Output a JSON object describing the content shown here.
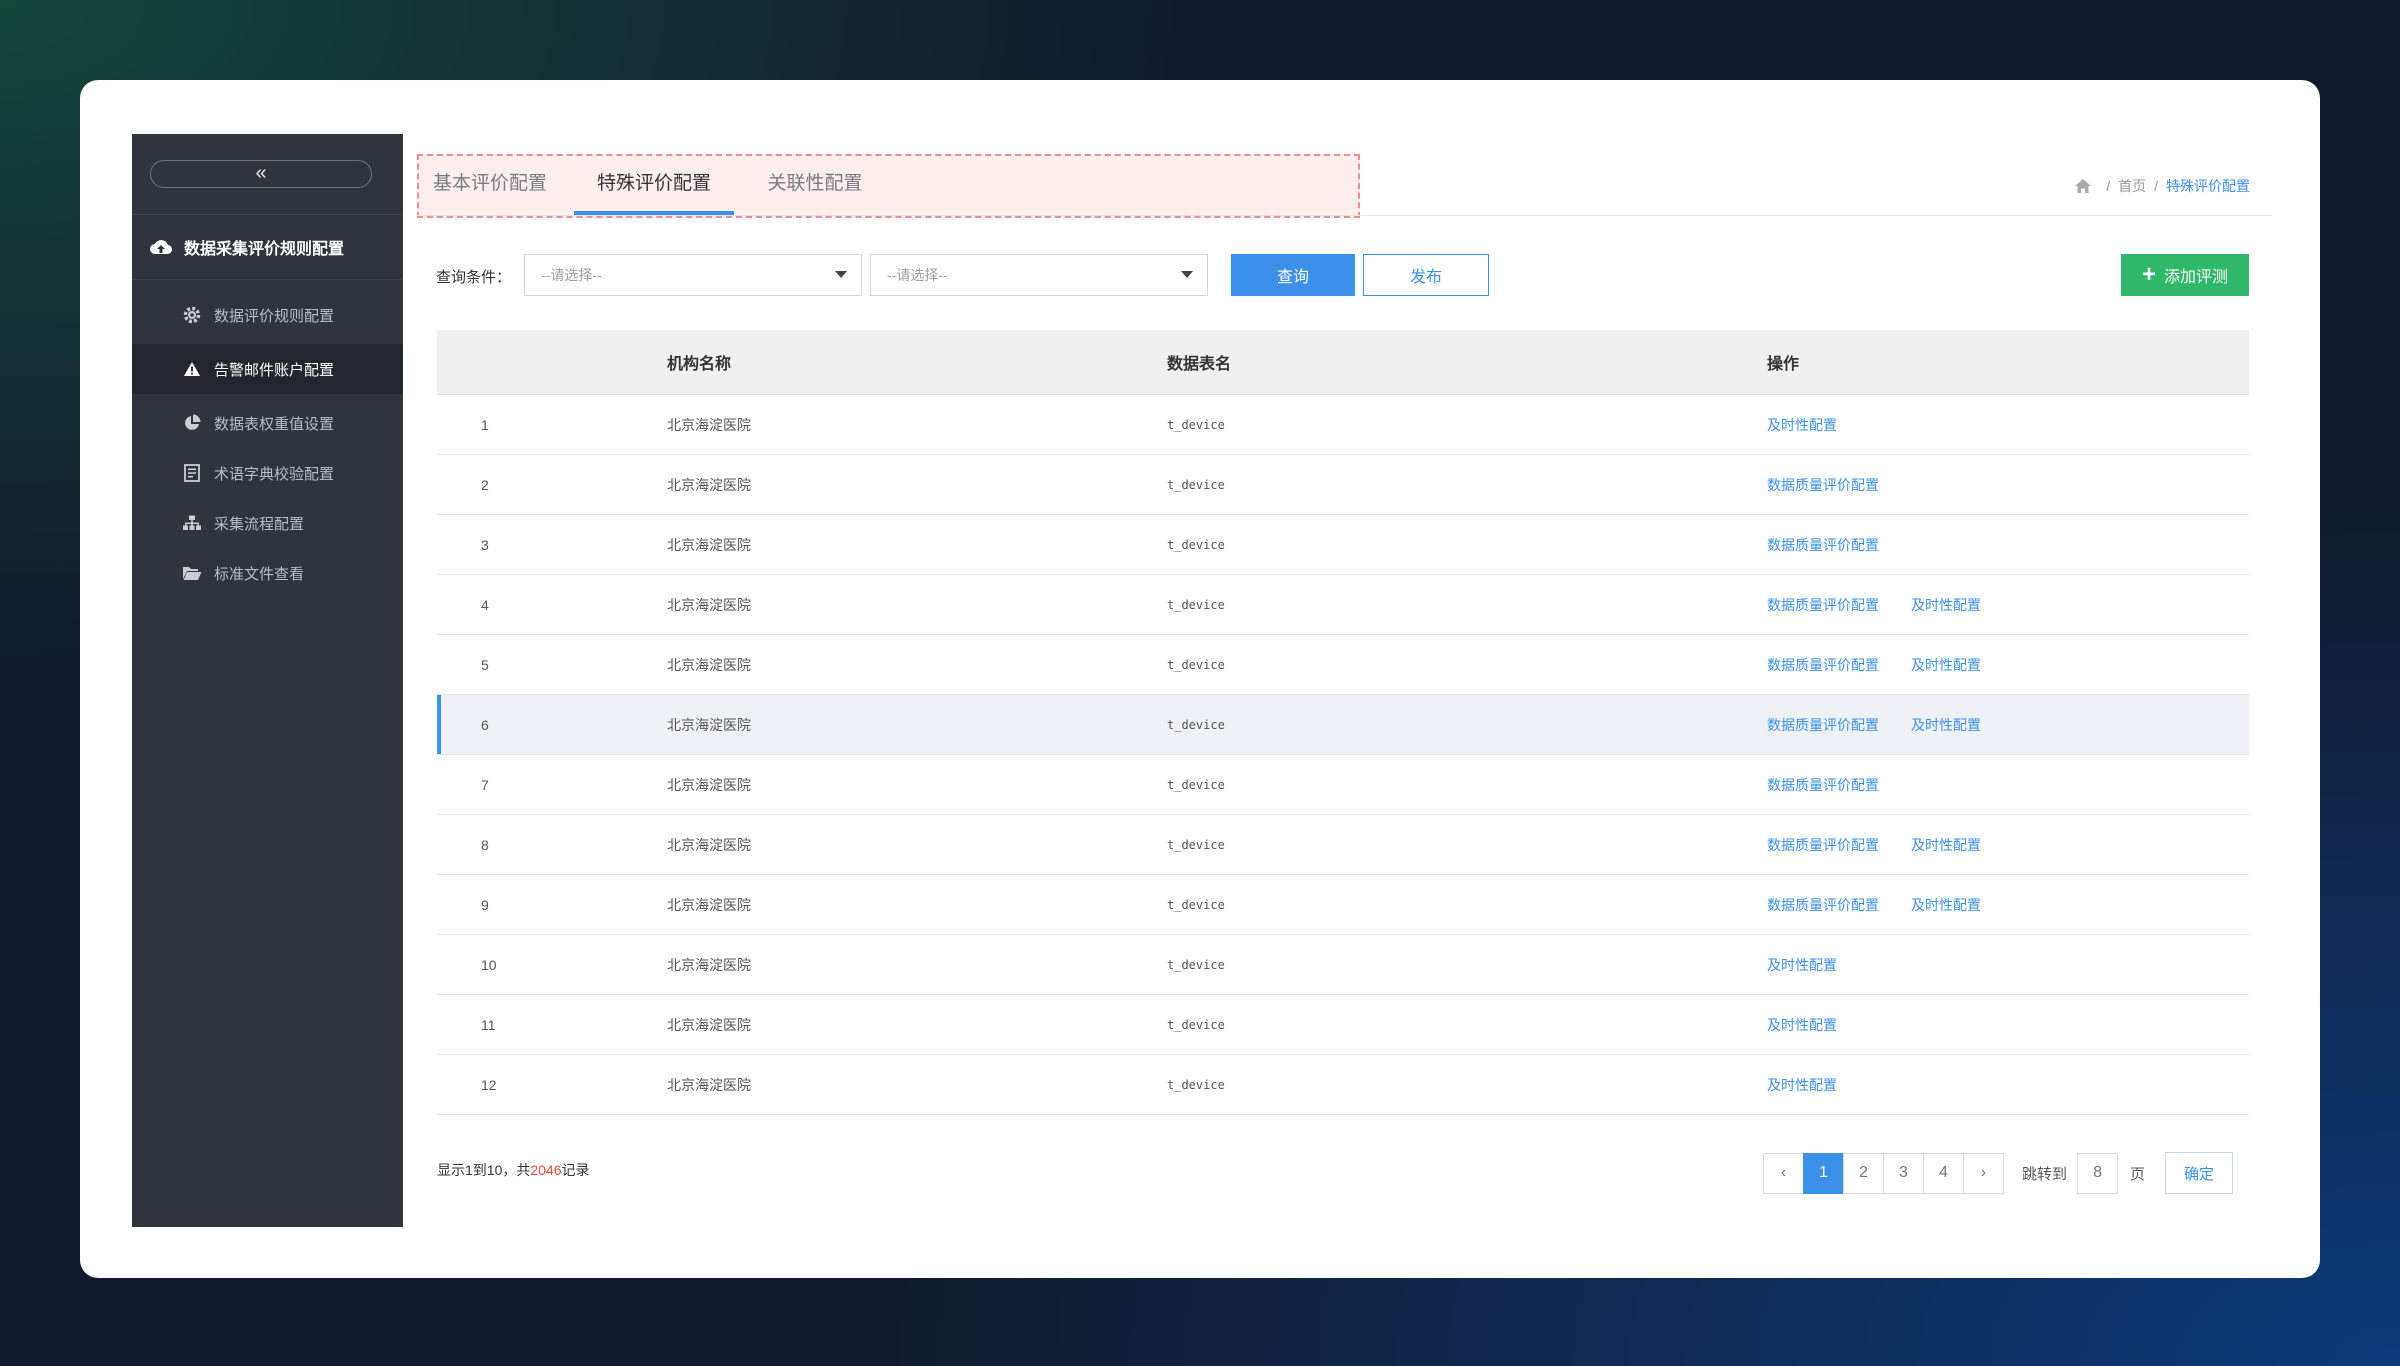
{
  "sidebar": {
    "collapse_glyph": "«",
    "group_label": "数据采集评价规则配置",
    "items": [
      {
        "label": "数据评价规则配置",
        "icon": "gear-icon"
      },
      {
        "label": "告警邮件账户配置",
        "icon": "warning-icon"
      },
      {
        "label": "数据表权重值设置",
        "icon": "pie-chart-icon"
      },
      {
        "label": "术语字典校验配置",
        "icon": "dictionary-icon"
      },
      {
        "label": "采集流程配置",
        "icon": "flow-icon"
      },
      {
        "label": "标准文件查看",
        "icon": "folder-open-icon"
      }
    ]
  },
  "tabs": [
    {
      "label": "基本评价配置"
    },
    {
      "label": "特殊评价配置"
    },
    {
      "label": "关联性配置"
    }
  ],
  "breadcrumb": {
    "home": "首页",
    "separator": "/",
    "current": "特殊评价配置"
  },
  "filter": {
    "label": "查询条件：",
    "select1_placeholder": "--请选择--",
    "select2_placeholder": "--请选择--",
    "query_button": "查询",
    "publish_button": "发布",
    "add_button": "添加评测",
    "add_plus": "+"
  },
  "table": {
    "headers": [
      "",
      "机构名称",
      "数据表名",
      "操作"
    ],
    "rows": [
      {
        "no": "1",
        "org": "北京海淀医院",
        "table": "t_device",
        "ops": [
          "及时性配置"
        ]
      },
      {
        "no": "2",
        "org": "北京海淀医院",
        "table": "t_device",
        "ops": [
          "数据质量评价配置"
        ]
      },
      {
        "no": "3",
        "org": "北京海淀医院",
        "table": "t_device",
        "ops": [
          "数据质量评价配置"
        ]
      },
      {
        "no": "4",
        "org": "北京海淀医院",
        "table": "t_device",
        "ops": [
          "数据质量评价配置",
          "及时性配置"
        ]
      },
      {
        "no": "5",
        "org": "北京海淀医院",
        "table": "t_device",
        "ops": [
          "数据质量评价配置",
          "及时性配置"
        ]
      },
      {
        "no": "6",
        "org": "北京海淀医院",
        "table": "t_device",
        "ops": [
          "数据质量评价配置",
          "及时性配置"
        ]
      },
      {
        "no": "7",
        "org": "北京海淀医院",
        "table": "t_device",
        "ops": [
          "数据质量评价配置"
        ]
      },
      {
        "no": "8",
        "org": "北京海淀医院",
        "table": "t_device",
        "ops": [
          "数据质量评价配置",
          "及时性配置"
        ]
      },
      {
        "no": "9",
        "org": "北京海淀医院",
        "table": "t_device",
        "ops": [
          "数据质量评价配置",
          "及时性配置"
        ]
      },
      {
        "no": "10",
        "org": "北京海淀医院",
        "table": "t_device",
        "ops": [
          "及时性配置"
        ]
      },
      {
        "no": "11",
        "org": "北京海淀医院",
        "table": "t_device",
        "ops": [
          "及时性配置"
        ]
      },
      {
        "no": "12",
        "org": "北京海淀医院",
        "table": "t_device",
        "ops": [
          "及时性配置"
        ]
      }
    ]
  },
  "summary": {
    "prefix": "显示1到10，共",
    "total": "2046",
    "suffix": "记录"
  },
  "pagination": {
    "prev": "‹",
    "next": "›",
    "pages": [
      "1",
      "2",
      "3",
      "4"
    ],
    "jump_label": "跳转到",
    "jump_value": "8",
    "unit": "页",
    "confirm": "确定"
  },
  "colors": {
    "accent": "#3b90e8",
    "success": "#2fb86a",
    "sidebar": "#30353d",
    "highlight": "#e74c3c"
  }
}
